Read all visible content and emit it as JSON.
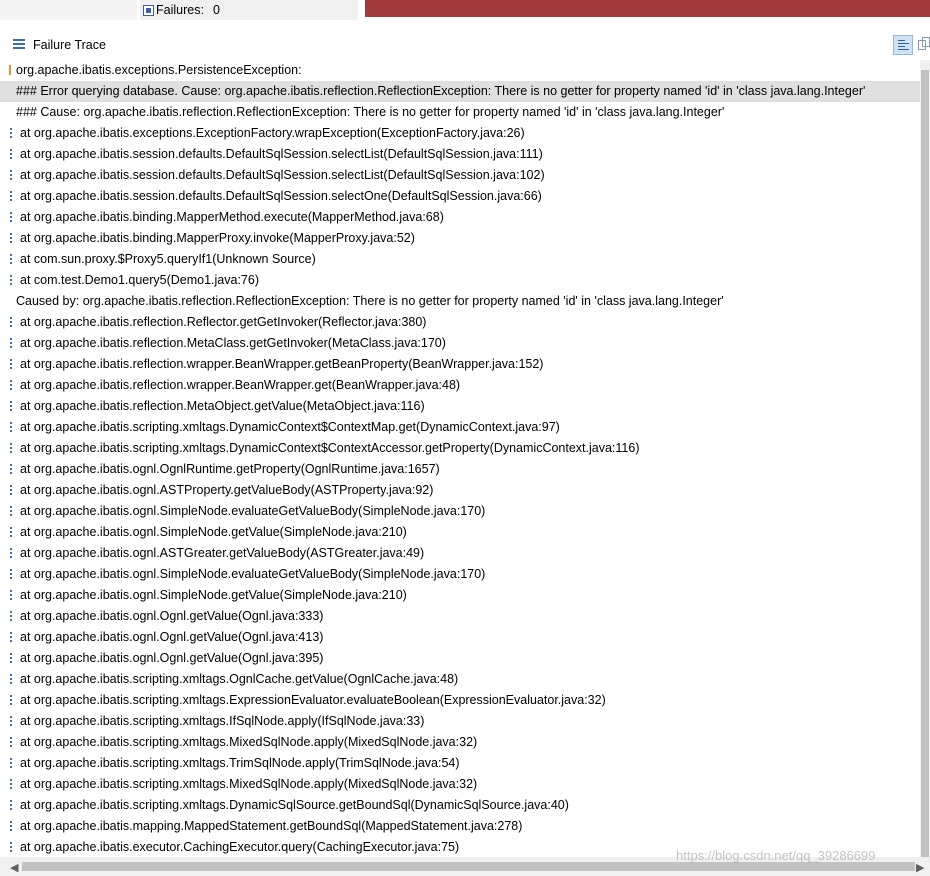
{
  "status": {
    "failures_label": "Failures:",
    "failures_count": "0"
  },
  "header": {
    "title": "Failure Trace"
  },
  "trace": [
    {
      "kind": "exception",
      "text": "org.apache.ibatis.exceptions.PersistenceException:"
    },
    {
      "kind": "message",
      "text": "### Error querying database.  Cause: org.apache.ibatis.reflection.ReflectionException: There is no getter for property named 'id' in 'class java.lang.Integer'",
      "selected": true
    },
    {
      "kind": "message",
      "text": "### Cause: org.apache.ibatis.reflection.ReflectionException: There is no getter for property named 'id' in 'class java.lang.Integer'"
    },
    {
      "kind": "frame",
      "text": "at org.apache.ibatis.exceptions.ExceptionFactory.wrapException(ExceptionFactory.java:26)"
    },
    {
      "kind": "frame",
      "text": "at org.apache.ibatis.session.defaults.DefaultSqlSession.selectList(DefaultSqlSession.java:111)"
    },
    {
      "kind": "frame",
      "text": "at org.apache.ibatis.session.defaults.DefaultSqlSession.selectList(DefaultSqlSession.java:102)"
    },
    {
      "kind": "frame",
      "text": "at org.apache.ibatis.session.defaults.DefaultSqlSession.selectOne(DefaultSqlSession.java:66)"
    },
    {
      "kind": "frame",
      "text": "at org.apache.ibatis.binding.MapperMethod.execute(MapperMethod.java:68)"
    },
    {
      "kind": "frame",
      "text": "at org.apache.ibatis.binding.MapperProxy.invoke(MapperProxy.java:52)"
    },
    {
      "kind": "frame",
      "text": "at com.sun.proxy.$Proxy5.queryIf1(Unknown Source)"
    },
    {
      "kind": "frame",
      "text": "at com.test.Demo1.query5(Demo1.java:76)"
    },
    {
      "kind": "message",
      "text": "Caused by: org.apache.ibatis.reflection.ReflectionException: There is no getter for property named 'id' in 'class java.lang.Integer'"
    },
    {
      "kind": "frame",
      "text": "at org.apache.ibatis.reflection.Reflector.getGetInvoker(Reflector.java:380)"
    },
    {
      "kind": "frame",
      "text": "at org.apache.ibatis.reflection.MetaClass.getGetInvoker(MetaClass.java:170)"
    },
    {
      "kind": "frame",
      "text": "at org.apache.ibatis.reflection.wrapper.BeanWrapper.getBeanProperty(BeanWrapper.java:152)"
    },
    {
      "kind": "frame",
      "text": "at org.apache.ibatis.reflection.wrapper.BeanWrapper.get(BeanWrapper.java:48)"
    },
    {
      "kind": "frame",
      "text": "at org.apache.ibatis.reflection.MetaObject.getValue(MetaObject.java:116)"
    },
    {
      "kind": "frame",
      "text": "at org.apache.ibatis.scripting.xmltags.DynamicContext$ContextMap.get(DynamicContext.java:97)"
    },
    {
      "kind": "frame",
      "text": "at org.apache.ibatis.scripting.xmltags.DynamicContext$ContextAccessor.getProperty(DynamicContext.java:116)"
    },
    {
      "kind": "frame",
      "text": "at org.apache.ibatis.ognl.OgnlRuntime.getProperty(OgnlRuntime.java:1657)"
    },
    {
      "kind": "frame",
      "text": "at org.apache.ibatis.ognl.ASTProperty.getValueBody(ASTProperty.java:92)"
    },
    {
      "kind": "frame",
      "text": "at org.apache.ibatis.ognl.SimpleNode.evaluateGetValueBody(SimpleNode.java:170)"
    },
    {
      "kind": "frame",
      "text": "at org.apache.ibatis.ognl.SimpleNode.getValue(SimpleNode.java:210)"
    },
    {
      "kind": "frame",
      "text": "at org.apache.ibatis.ognl.ASTGreater.getValueBody(ASTGreater.java:49)"
    },
    {
      "kind": "frame",
      "text": "at org.apache.ibatis.ognl.SimpleNode.evaluateGetValueBody(SimpleNode.java:170)"
    },
    {
      "kind": "frame",
      "text": "at org.apache.ibatis.ognl.SimpleNode.getValue(SimpleNode.java:210)"
    },
    {
      "kind": "frame",
      "text": "at org.apache.ibatis.ognl.Ognl.getValue(Ognl.java:333)"
    },
    {
      "kind": "frame",
      "text": "at org.apache.ibatis.ognl.Ognl.getValue(Ognl.java:413)"
    },
    {
      "kind": "frame",
      "text": "at org.apache.ibatis.ognl.Ognl.getValue(Ognl.java:395)"
    },
    {
      "kind": "frame",
      "text": "at org.apache.ibatis.scripting.xmltags.OgnlCache.getValue(OgnlCache.java:48)"
    },
    {
      "kind": "frame",
      "text": "at org.apache.ibatis.scripting.xmltags.ExpressionEvaluator.evaluateBoolean(ExpressionEvaluator.java:32)"
    },
    {
      "kind": "frame",
      "text": "at org.apache.ibatis.scripting.xmltags.IfSqlNode.apply(IfSqlNode.java:33)"
    },
    {
      "kind": "frame",
      "text": "at org.apache.ibatis.scripting.xmltags.MixedSqlNode.apply(MixedSqlNode.java:32)"
    },
    {
      "kind": "frame",
      "text": "at org.apache.ibatis.scripting.xmltags.TrimSqlNode.apply(TrimSqlNode.java:54)"
    },
    {
      "kind": "frame",
      "text": "at org.apache.ibatis.scripting.xmltags.MixedSqlNode.apply(MixedSqlNode.java:32)"
    },
    {
      "kind": "frame",
      "text": "at org.apache.ibatis.scripting.xmltags.DynamicSqlSource.getBoundSql(DynamicSqlSource.java:40)"
    },
    {
      "kind": "frame",
      "text": "at org.apache.ibatis.mapping.MappedStatement.getBoundSql(MappedStatement.java:278)"
    },
    {
      "kind": "frame",
      "text": "at org.apache.ibatis.executor.CachingExecutor.query(CachingExecutor.java:75)"
    }
  ],
  "watermark": "https://blog.csdn.net/qq_39286699",
  "colors": {
    "failure_bar": "#a13a3a",
    "selected_row": "#e0e0e0",
    "icon_blue": "#3b6fb5"
  }
}
